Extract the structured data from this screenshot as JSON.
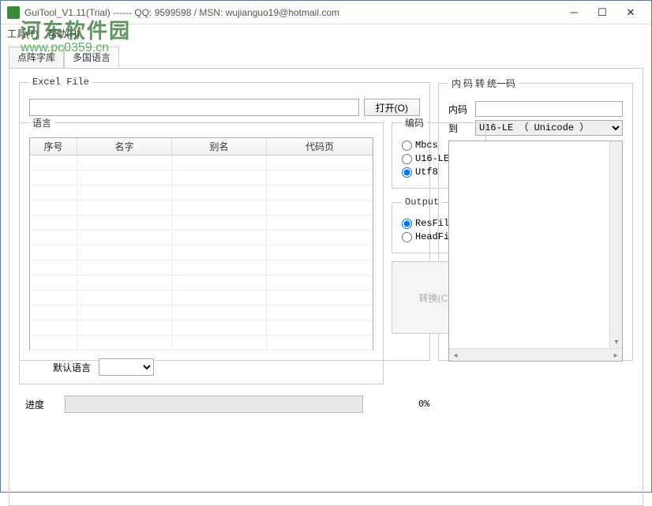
{
  "window": {
    "title": "GuiTool_V1.11(Trial) ------ QQ: 9599598 / MSN: wujianguo19@hotmail.com"
  },
  "menu": {
    "tools": "工具(T)",
    "help": "帮助(H)"
  },
  "watermark": {
    "brand": "河东软件园",
    "url": "www.pc0359.cn"
  },
  "tabs": {
    "t1": "点阵字库",
    "t2": "多国语言"
  },
  "excel": {
    "legend": "Excel File",
    "path": "",
    "open": "打开(O)"
  },
  "lang": {
    "legend": "语言",
    "cols": {
      "no": "序号",
      "name": "名字",
      "alias": "别名",
      "codepage": "代码页"
    },
    "default_label": "默认语言",
    "default_value": ""
  },
  "encoding": {
    "legend": "编码",
    "mbcs": "Mbcs",
    "u16": "U16-LE",
    "utf8": "Utf8",
    "selected": "Utf8"
  },
  "output": {
    "legend": "Output",
    "resfile": "ResFile",
    "headfile": "HeadFile",
    "selected": "ResFile"
  },
  "convert": {
    "label": "转换(C)..."
  },
  "codeconv": {
    "legend": "内 码 转 统一码",
    "innercode_label": "内码",
    "innercode_value": "",
    "to_label": "到",
    "to_value": "U16-LE （ Unicode ）",
    "output": ""
  },
  "progress": {
    "label": "进度",
    "percent": "0%"
  }
}
